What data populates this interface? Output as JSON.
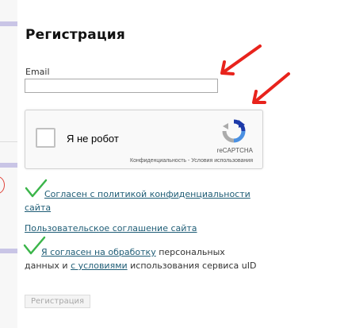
{
  "form": {
    "title": "Регистрация",
    "email_label": "Email",
    "email_value": "",
    "submit_label": "Регистрация"
  },
  "captcha": {
    "label": "Я не робот",
    "brand": "reCAPTCHA",
    "privacy_link": "Конфиденциальность",
    "separator": " - ",
    "terms_link": "Условия использования",
    "checked": false
  },
  "agreements": {
    "policy_link": "Согласен с политикой конфиденциальности сайта",
    "user_agreement_link": "Пользовательское соглашение сайта",
    "consent_link": "Я согласен на обработку",
    "consent_text_1": " персональных данных и ",
    "conditions_link": "с условиями",
    "consent_text_2": " использования сервиса uID"
  },
  "icons": {
    "captcha_logo": "recaptcha-logo-icon",
    "checkmark": "green-checkmark-icon",
    "annotation": "red-arrow-icon"
  },
  "colors": {
    "link": "#1f5d76",
    "checkmark": "#3bb54a",
    "annotation": "#e8231c",
    "side_bar": "#c9c5e6"
  }
}
